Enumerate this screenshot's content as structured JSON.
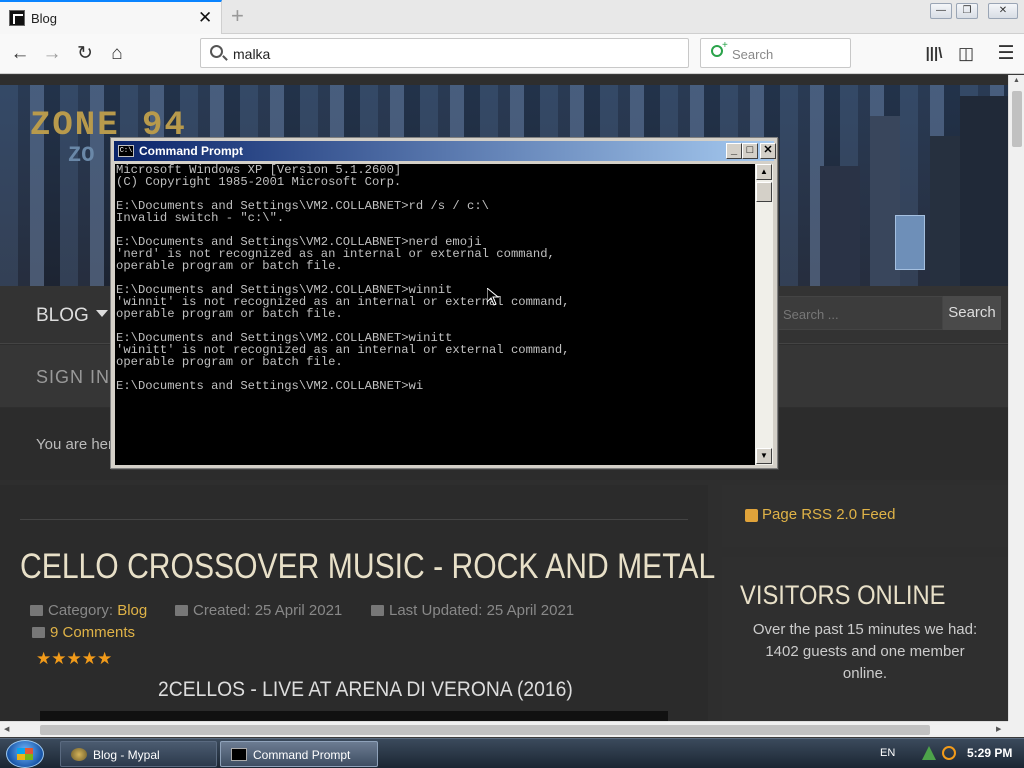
{
  "browser": {
    "tab_title": "Blog",
    "tab_close": "✕",
    "new_tab": "+",
    "url": "malka",
    "search_placeholder": "Search"
  },
  "site": {
    "logo_line1": "ZONE 94",
    "logo_line2": "ZO",
    "menu_blog": "BLOG",
    "search_placeholder": "Search ...",
    "search_button": "Search",
    "signin": "SIGN IN",
    "breadcrumb": "You are here:"
  },
  "article": {
    "title": "CELLO CROSSOVER MUSIC - ROCK AND METAL",
    "category_label": "Category:",
    "category_value": "Blog",
    "created": "Created: 25 April 2021",
    "updated": "Last Updated: 25 April 2021",
    "comments": "9 Comments",
    "stars": "★★★★★",
    "rating": 5,
    "video_title": "2CELLOS - LIVE AT ARENA DI VERONA (2016)"
  },
  "sidebar": {
    "rss": "Page RSS 2.0 Feed",
    "visitors_title": "VISITORS ONLINE",
    "visitors_text": "Over the past 15 minutes we had: 1402 guests and one member online."
  },
  "cmd": {
    "title": "Command Prompt",
    "icon_text": "C:\\",
    "lines": [
      "Microsoft Windows XP [Version 5.1.2600]",
      "(C) Copyright 1985-2001 Microsoft Corp.",
      "",
      "E:\\Documents and Settings\\VM2.COLLABNET>rd /s / c:\\",
      "Invalid switch - \"c:\\\".",
      "",
      "E:\\Documents and Settings\\VM2.COLLABNET>nerd emoji",
      "'nerd' is not recognized as an internal or external command,",
      "operable program or batch file.",
      "",
      "E:\\Documents and Settings\\VM2.COLLABNET>winnit",
      "'winnit' is not recognized as an internal or external command,",
      "operable program or batch file.",
      "",
      "E:\\Documents and Settings\\VM2.COLLABNET>winitt",
      "'winitt' is not recognized as an internal or external command,",
      "operable program or batch file.",
      "",
      "E:\\Documents and Settings\\VM2.COLLABNET>wi"
    ]
  },
  "taskbar": {
    "tasks": [
      "Blog - Mypal",
      "Command Prompt"
    ],
    "active_task": "Command Prompt",
    "language": "EN",
    "clock": "5:29 PM"
  },
  "colors": {
    "accent": "#e0b347",
    "star": "#f29b1a",
    "cmd_title_start": "#0a246a",
    "cmd_title_end": "#a6caf0"
  }
}
